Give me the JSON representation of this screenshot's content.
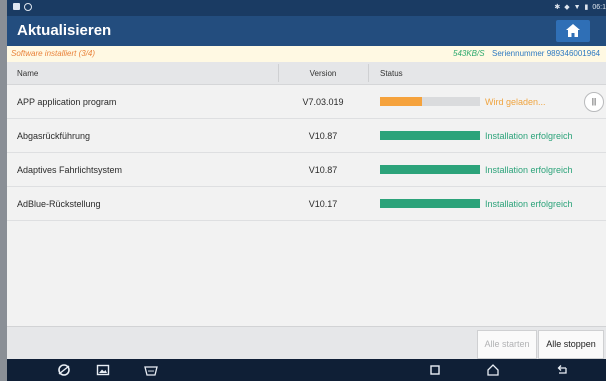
{
  "statusbar": {
    "time": "06:1"
  },
  "header": {
    "title": "Aktualisieren"
  },
  "info": {
    "install_status": "Software installiert (3/4)",
    "speed": "543KB/S",
    "serial_label": "Seriennummer",
    "serial_value": "989346001964"
  },
  "table": {
    "headers": {
      "name": "Name",
      "version": "Version",
      "status": "Status"
    },
    "rows": [
      {
        "name": "APP application program",
        "version": "V7.03.019",
        "status": "Wird geladen...",
        "progress": 0.42,
        "color": "#f5a23c",
        "text_color": "#f0a43f"
      },
      {
        "name": "Abgasrückführung",
        "version": "V10.87",
        "status": "Installation erfolgreich",
        "progress": 1.0,
        "color": "#2ca37a",
        "text_color": "#2ca37a"
      },
      {
        "name": "Adaptives Fahrlichtsystem",
        "version": "V10.87",
        "status": "Installation erfolgreich",
        "progress": 1.0,
        "color": "#2ca37a",
        "text_color": "#2ca37a"
      },
      {
        "name": "AdBlue-Rückstellung",
        "version": "V10.17",
        "status": "Installation erfolgreich",
        "progress": 1.0,
        "color": "#2ca37a",
        "text_color": "#2ca37a"
      }
    ]
  },
  "buttons": {
    "start_all": "Alle starten",
    "stop_all": "Alle stoppen"
  },
  "navbar": {
    "icons": [
      "browser-icon",
      "gallery-icon",
      "vci-icon",
      "recents-icon",
      "home-icon",
      "back-icon"
    ]
  }
}
